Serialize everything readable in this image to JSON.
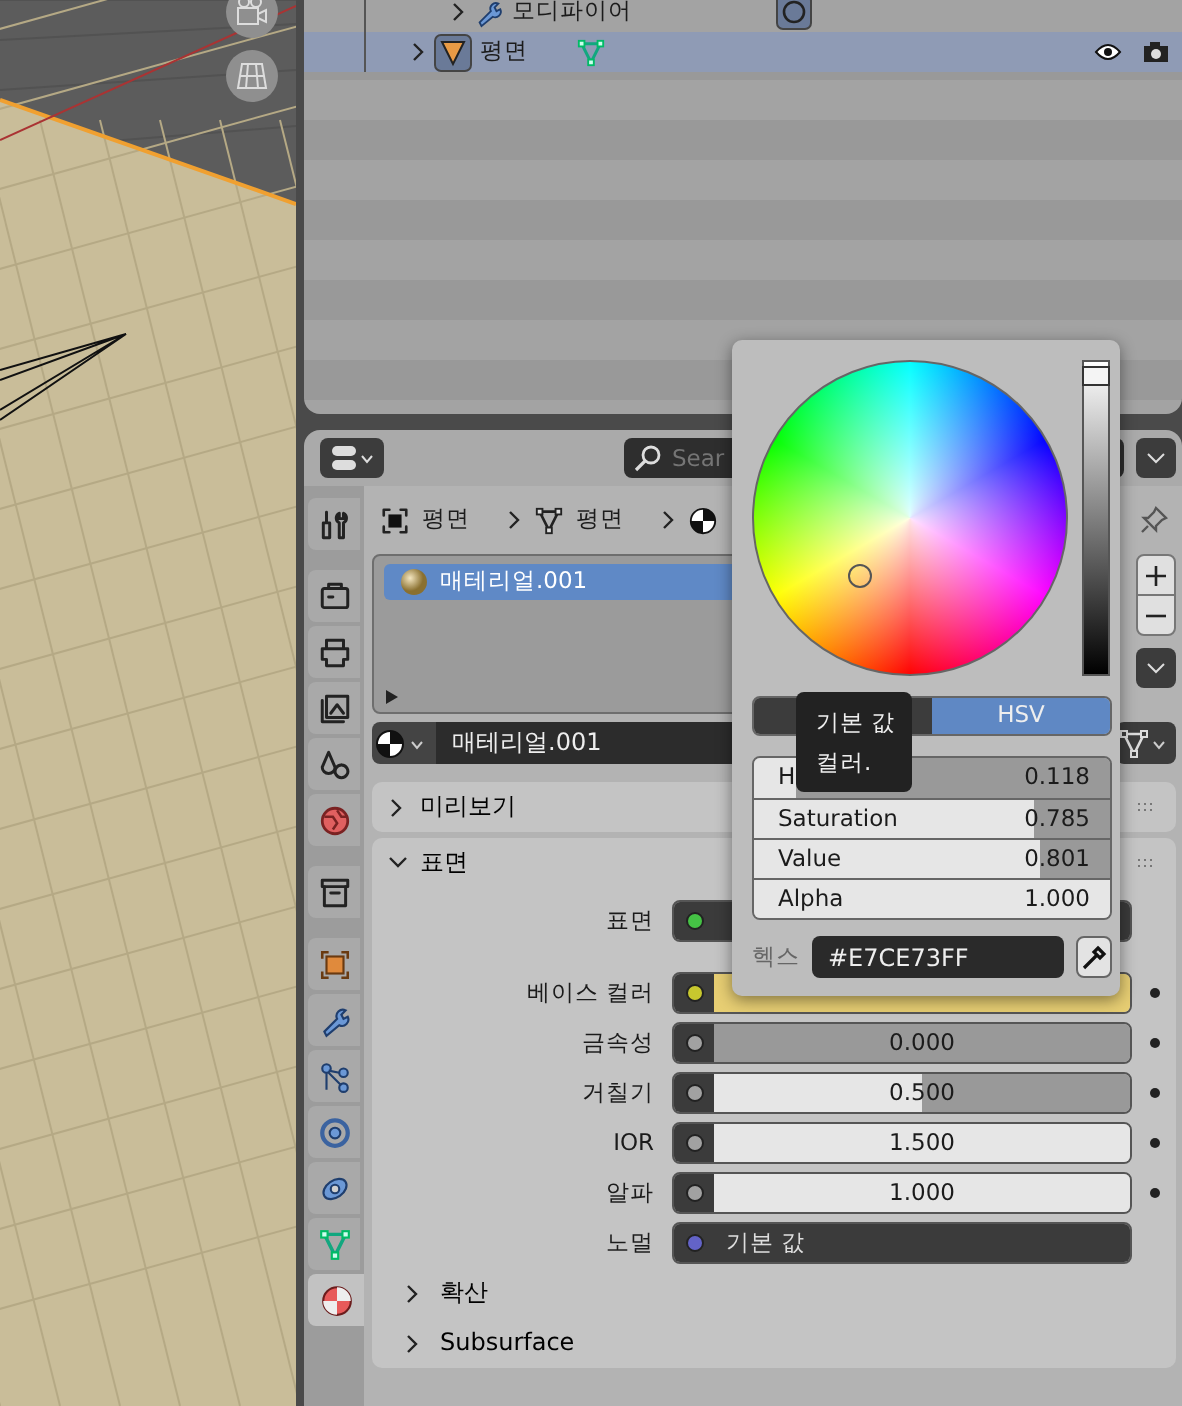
{
  "outliner": {
    "rows": [
      {
        "label": "모디파이어",
        "kind": "modifier",
        "selected": false
      },
      {
        "label": "평면",
        "kind": "object",
        "selected": true
      }
    ]
  },
  "properties": {
    "search": {
      "placeholder": "Sear"
    },
    "tabs": [
      {
        "kind": "tool",
        "selected": false
      },
      {
        "kind": "render",
        "selected": false
      },
      {
        "kind": "output",
        "selected": false
      },
      {
        "kind": "view_layer",
        "selected": false
      },
      {
        "kind": "scene",
        "selected": false
      },
      {
        "kind": "world",
        "selected": false
      },
      {
        "kind": "collection",
        "selected": false
      },
      {
        "kind": "object",
        "selected": false
      },
      {
        "kind": "modifier",
        "selected": false
      },
      {
        "kind": "particles",
        "selected": false
      },
      {
        "kind": "physics",
        "selected": false
      },
      {
        "kind": "constraint",
        "selected": false
      },
      {
        "kind": "data",
        "selected": false
      },
      {
        "kind": "material",
        "selected": true
      }
    ],
    "breadcrumb": [
      {
        "kind": "object",
        "label": "평면"
      },
      {
        "kind": "mesh",
        "label": "평면"
      },
      {
        "kind": "material"
      }
    ],
    "slots": [
      {
        "label": "매테리얼.001",
        "selected": true
      }
    ],
    "material_name": "매테리얼.001",
    "panels": [
      {
        "label": "미리보기",
        "expanded": false
      },
      {
        "label": "표면",
        "expanded": true
      }
    ],
    "surface": [
      {
        "label": "표면",
        "kind": "shader",
        "color": "#45c245"
      },
      {
        "label": "베이스 컬러",
        "kind": "color",
        "color": "#c7c72e"
      },
      {
        "label": "금속성",
        "kind": "slider",
        "color": "#a1a1a1",
        "value": "0.000",
        "level": 0
      },
      {
        "label": "거칠기",
        "kind": "slider",
        "color": "#a1a1a1",
        "value": "0.500",
        "level": 0.5
      },
      {
        "label": "IOR",
        "kind": "slider",
        "color": "#a1a1a1",
        "value": "1.500",
        "level": 1
      },
      {
        "label": "알파",
        "kind": "slider",
        "color": "#a1a1a1",
        "value": "1.000",
        "level": 1
      },
      {
        "label": "노멀",
        "kind": "link",
        "color": "#6363c7",
        "value": "기본 값"
      }
    ],
    "subpanels": [
      {
        "label": "확산",
        "expanded": false
      },
      {
        "label": "Subsurface",
        "expanded": false
      }
    ]
  },
  "color_picker": {
    "modes": [
      {
        "selected": false
      },
      {
        "label": "HSV",
        "selected": true
      }
    ],
    "fields": [
      {
        "label": "H",
        "value": "0.118",
        "level": 0.118
      },
      {
        "label": "Saturation",
        "value": "0.785",
        "level": 0.785
      },
      {
        "label": "Value",
        "value": "0.801",
        "level": 0.801
      },
      {
        "label": "Alpha",
        "value": "1.000",
        "level": 1
      }
    ],
    "hex_label": "헥스",
    "hex": "#E7CE73FF"
  },
  "tooltip": {
    "lines": [
      "기본 값",
      "컬러."
    ]
  }
}
